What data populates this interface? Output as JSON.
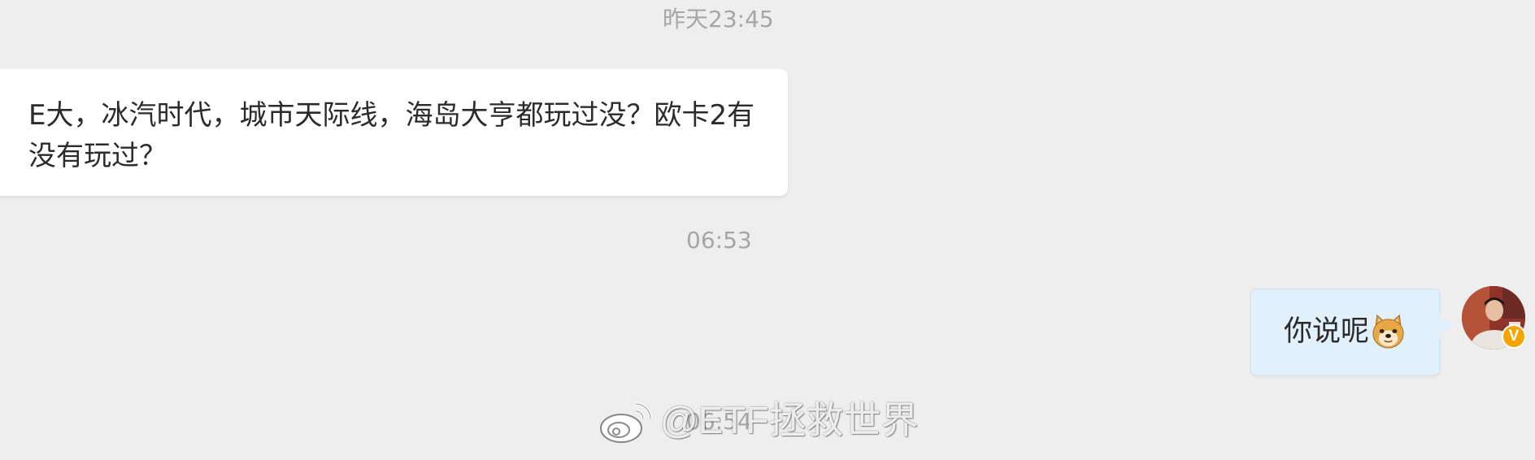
{
  "messages": [
    {
      "timestamp": "昨天23:45",
      "sender": "other",
      "text": "E大，冰汽时代，城市天际线，海岛大亨都玩过没？欧卡2有没有玩过？"
    },
    {
      "timestamp": "06:53",
      "sender": "me",
      "text": "你说呢",
      "emoji": "doge-emoji",
      "avatar": {
        "icon": "user-avatar",
        "verified_badge": "V",
        "badge_color": "#f5a400"
      }
    },
    {
      "timestamp": "06:54"
    }
  ],
  "watermark": {
    "icon": "weibo-logo-icon",
    "text": "@ETF拯救世界"
  },
  "colors": {
    "background": "#eeeeee",
    "incoming_bubble": "#ffffff",
    "outgoing_bubble": "#e2f0fc",
    "timestamp_text": "#a6a6a6"
  }
}
